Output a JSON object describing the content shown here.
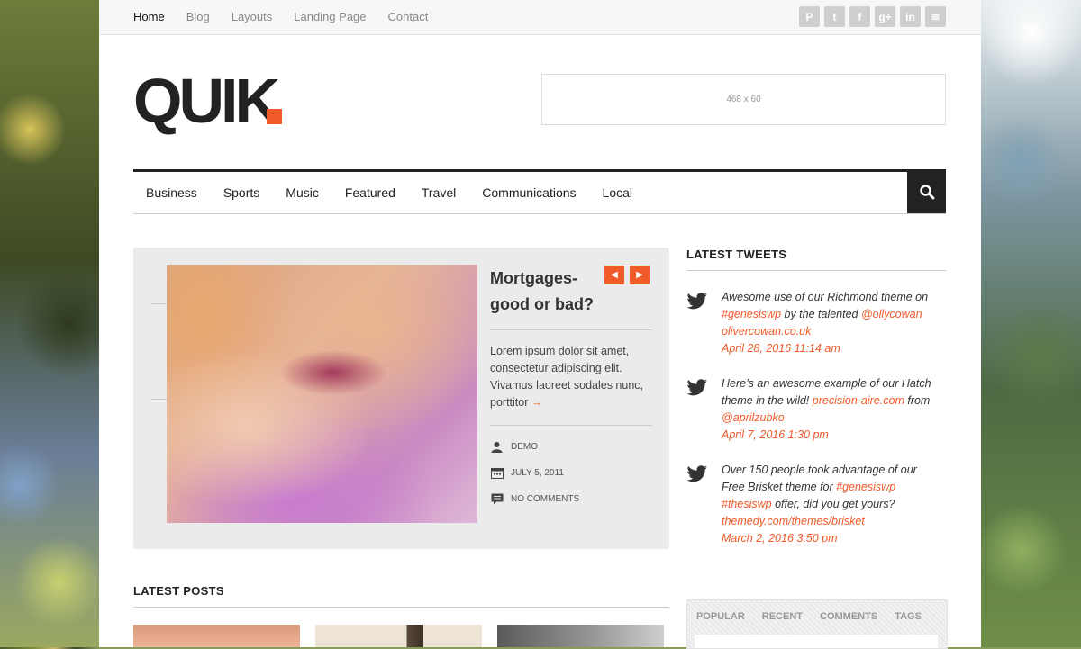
{
  "topnav": {
    "items": [
      "Home",
      "Blog",
      "Layouts",
      "Landing Page",
      "Contact"
    ]
  },
  "social": {
    "icons": [
      "pinterest-icon",
      "twitter-icon",
      "facebook-icon",
      "googleplus-icon",
      "linkedin-icon",
      "rss-icon"
    ],
    "glyphs": [
      "P",
      "t",
      "f",
      "g+",
      "in",
      "≋"
    ]
  },
  "header": {
    "logo_text": "QUIK",
    "ad_text": "468 x 60"
  },
  "mainnav": {
    "items": [
      "Business",
      "Sports",
      "Music",
      "Featured",
      "Travel",
      "Communications",
      "Local"
    ]
  },
  "featured": {
    "title": "Mortgages- good or bad?",
    "excerpt": "Lorem ipsum dolor sit amet, consectetur adipiscing elit. Vivamus laoreet sodales nunc, porttitor",
    "read_more": "→",
    "author": "DEMO",
    "date": "JULY 5, 2011",
    "comments": "NO COMMENTS"
  },
  "latest_posts": {
    "title": "LATEST POSTS"
  },
  "sidebar": {
    "tweets_title": "LATEST TWEETS",
    "tweets": [
      {
        "parts": [
          "Awesome use of our Richmond theme on ",
          "#genesiswp",
          " by the talented ",
          "@ollycowan",
          " ",
          "olivercowan.co.uk"
        ],
        "time": "April 28, 2016 11:14 am"
      },
      {
        "parts": [
          "Here’s an awesome example of our Hatch theme in the wild! ",
          "precision-aire.com",
          " from ",
          "@aprilzubko"
        ],
        "time": "April 7, 2016 1:30 pm"
      },
      {
        "parts": [
          "Over 150 people took advantage of our Free Brisket theme for ",
          "#genesiswp",
          " ",
          "#thesiswp",
          " offer, did you get yours? ",
          "themedy.com/themes/brisket"
        ],
        "time": "March 2, 2016 3:50 pm"
      }
    ],
    "tabs": [
      "POPULAR",
      "RECENT",
      "COMMENTS",
      "TAGS"
    ]
  },
  "colors": {
    "accent": "#f15a29",
    "dark": "#222222"
  }
}
